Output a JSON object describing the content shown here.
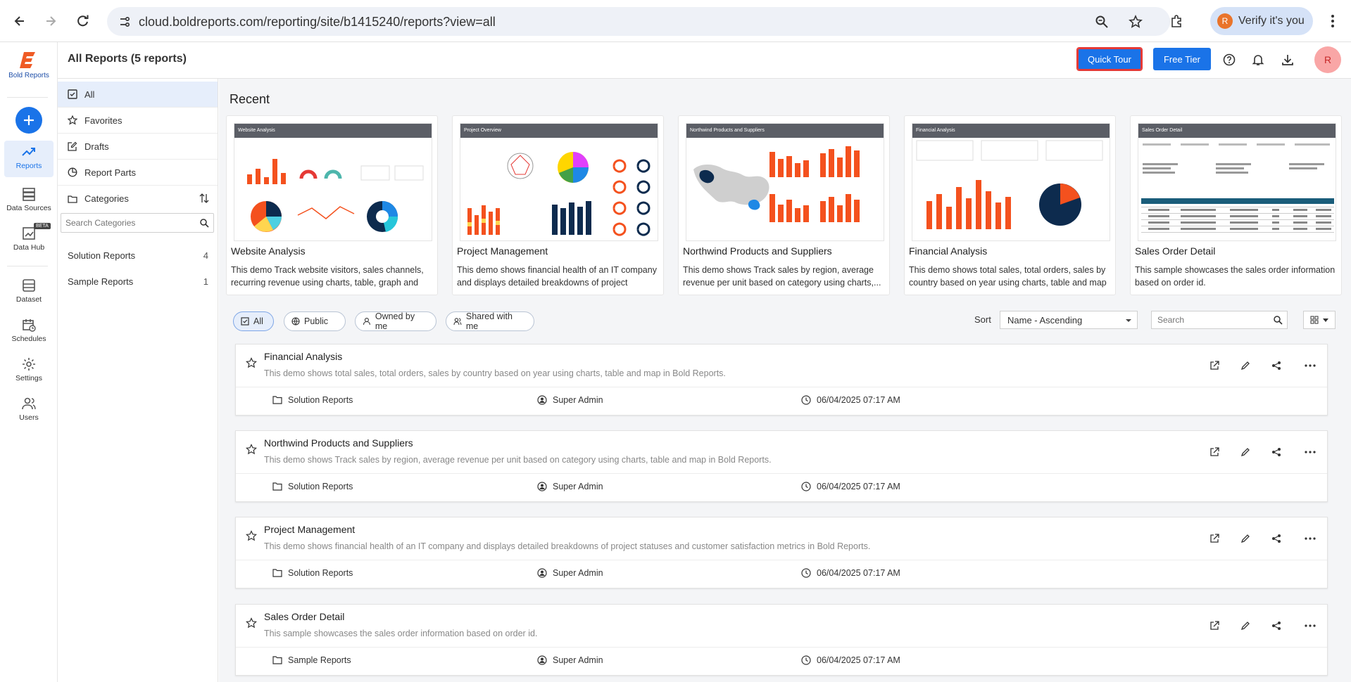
{
  "browser": {
    "url": "cloud.boldreports.com/reporting/site/b1415240/reports?view=all",
    "verify_label": "Verify it's you",
    "avatar_letter": "R"
  },
  "rail": {
    "logo_text": "Bold Reports",
    "items": [
      {
        "label": "Reports",
        "icon": "trend-icon"
      },
      {
        "label": "Data Sources",
        "icon": "database-icon"
      },
      {
        "label": "Data Hub",
        "icon": "datahub-icon",
        "badge": "BETA"
      },
      {
        "label": "Dataset",
        "icon": "dataset-icon"
      },
      {
        "label": "Schedules",
        "icon": "calendar-icon"
      },
      {
        "label": "Settings",
        "icon": "gear-icon"
      },
      {
        "label": "Users",
        "icon": "users-icon"
      }
    ]
  },
  "header": {
    "title": "All Reports (5 reports)",
    "quick_tour": "Quick Tour",
    "free_tier": "Free Tier",
    "avatar_letter": "R"
  },
  "sidebar": {
    "items": [
      {
        "label": "All"
      },
      {
        "label": "Favorites"
      },
      {
        "label": "Drafts"
      },
      {
        "label": "Report Parts"
      },
      {
        "label": "Categories"
      }
    ],
    "search_placeholder": "Search Categories",
    "categories": [
      {
        "name": "Solution Reports",
        "count": "4"
      },
      {
        "name": "Sample Reports",
        "count": "1"
      }
    ]
  },
  "recent": {
    "title": "Recent",
    "cards": [
      {
        "thumb_title": "Website Analysis",
        "title": "Website Analysis",
        "desc": "This demo Track website visitors, sales channels, recurring revenue using charts, table, graph and radi..."
      },
      {
        "thumb_title": "Project Overview",
        "title": "Project Management",
        "desc": "This demo shows financial health of an IT company and displays detailed breakdowns of project statuse..."
      },
      {
        "thumb_title": "Northwind Products and Suppliers",
        "title": "Northwind Products and Suppliers",
        "desc": "This demo shows Track sales by region, average revenue per unit based on category using charts,..."
      },
      {
        "thumb_title": "Financial Analysis",
        "title": "Financial Analysis",
        "desc": "This demo shows total sales, total orders, sales by country based on year using charts, table and map i..."
      },
      {
        "thumb_title": "Sales Order Detail",
        "title": "Sales Order Detail",
        "desc": "This sample showcases the sales order information based on order id."
      }
    ]
  },
  "filters": {
    "chips": [
      "All",
      "Public",
      "Owned by me",
      "Shared with me"
    ],
    "sort_label": "Sort",
    "sort_value": "Name - Ascending",
    "search_placeholder": "Search"
  },
  "reports": [
    {
      "title": "Financial Analysis",
      "desc": "This demo shows total sales, total orders, sales by country based on year using charts, table and map in Bold Reports.",
      "category": "Solution Reports",
      "owner": "Super Admin",
      "date": "06/04/2025 07:17 AM"
    },
    {
      "title": "Northwind Products and Suppliers",
      "desc": "This demo shows Track sales by region, average revenue per unit based on category using charts, table and map in Bold Reports.",
      "category": "Solution Reports",
      "owner": "Super Admin",
      "date": "06/04/2025 07:17 AM"
    },
    {
      "title": "Project Management",
      "desc": "This demo shows financial health of an IT company and displays detailed breakdowns of project statuses and customer satisfaction metrics in Bold Reports.",
      "category": "Solution Reports",
      "owner": "Super Admin",
      "date": "06/04/2025 07:17 AM"
    },
    {
      "title": "Sales Order Detail",
      "desc": "This sample showcases the sales order information based on order id.",
      "category": "Sample Reports",
      "owner": "Super Admin",
      "date": "06/04/2025 07:17 AM"
    }
  ],
  "colors": {
    "accent": "#1a73e8",
    "bar": "#f4511e",
    "navy": "#0d2b4e"
  }
}
